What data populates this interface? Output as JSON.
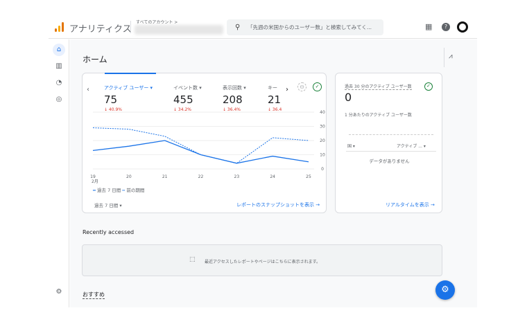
{
  "header": {
    "app_title": "アナリティクス",
    "account_label": "すべてのアカウント >",
    "search_placeholder": "「先週の米国からのユーザー数」と検索してみてく..."
  },
  "page_title": "ホーム",
  "metrics": [
    {
      "label": "アクティブ ユーザー",
      "value": "75",
      "delta": "↓ 40.9%"
    },
    {
      "label": "イベント数",
      "value": "455",
      "delta": "↓ 34.2%"
    },
    {
      "label": "表示回数",
      "value": "208",
      "delta": "↓ 36.4%"
    },
    {
      "label": "キー",
      "value": "21",
      "delta": "↓ 36.4"
    }
  ],
  "chart_data": {
    "type": "line",
    "x": [
      "19",
      "20",
      "21",
      "22",
      "23",
      "24",
      "25"
    ],
    "x_sub": "2月",
    "ylim": [
      0,
      40
    ],
    "yticks": [
      "40",
      "30",
      "20",
      "10",
      "0"
    ],
    "series": [
      {
        "name": "過去 7 日間",
        "values": [
          13,
          16,
          20,
          10,
          4,
          9,
          5
        ],
        "style": "solid"
      },
      {
        "name": "前の期間",
        "values": [
          29,
          28,
          23,
          10,
          4,
          22,
          20
        ],
        "style": "dashed"
      }
    ]
  },
  "date_range": "過去 7 日間",
  "snapshot_link": "レポートのスナップショットを表示",
  "realtime": {
    "title": "過去 30 分のアクティブ ユーザー数",
    "value": "0",
    "subtitle": "1 分あたりのアクティブ ユーザー数",
    "col1": "国 ▾",
    "col2": "アクティブ ... ▾",
    "empty": "データがありません",
    "link": "リアルタイムを表示"
  },
  "recent": {
    "title": "Recently accessed",
    "empty": "最近アクセスしたレポートやページはこちらに表示されます。"
  },
  "recommend": "おすすめ",
  "colors": {
    "accent": "#1a73e8",
    "negative": "#d93025"
  }
}
